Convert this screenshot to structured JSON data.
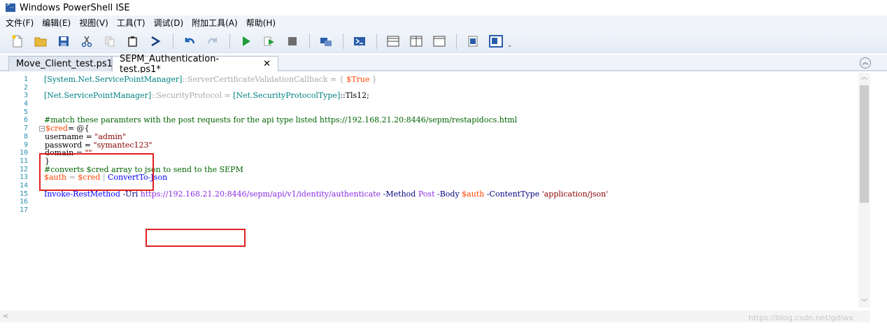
{
  "window": {
    "title": "Windows PowerShell ISE",
    "icon": "powershell-icon"
  },
  "menu": [
    "文件(F)",
    "编辑(E)",
    "视图(V)",
    "工具(T)",
    "调试(D)",
    "附加工具(A)",
    "帮助(H)"
  ],
  "toolbar": {
    "buttons": [
      "new-icon",
      "open-icon",
      "save-icon",
      "cut-icon",
      "copy-icon",
      "paste-icon",
      "console-icon",
      "undo-icon",
      "redo-icon",
      "run-icon",
      "run-selection-icon",
      "stop-icon",
      "remote-icon",
      "powershell-icon",
      "layout-top-icon",
      "layout-right-icon",
      "layout-max-icon",
      "addon-icon",
      "show-commands-icon"
    ],
    "overflow": "⌄"
  },
  "tabs": [
    {
      "label": "Move_Client_test.ps1",
      "active": false
    },
    {
      "label": "SEPM_Authentication-test.ps1*",
      "active": true,
      "close": "✕"
    }
  ],
  "editor": {
    "line_numbers": [
      "1",
      "2",
      "3",
      "4",
      "5",
      "6",
      "7",
      "8",
      "9",
      "10",
      "11",
      "12",
      "13",
      "14",
      "15",
      "16",
      "17"
    ],
    "code": {
      "l1_type": "[System.Net.ServicePointManager]",
      "l1_rest": "::ServerCertificateValidationCallback = { ",
      "l1_var": "$True",
      "l1_end": " }",
      "l3_type": "[Net.ServicePointManager]",
      "l3_mid": "::SecurityProtocol = ",
      "l3_type2": "[Net.SecurityProtocolType]",
      "l3_end": "::Tls12;",
      "l6_cmt": "#match these paramters with the post requests for the api type listed https://192.168.21.20:8446/sepm/restapidocs.html",
      "l7_fold": "−",
      "l7_var": "$cred",
      "l7_rest": "= @{",
      "l8_key": "username = ",
      "l8_val": "\"admin\"",
      "l9_key": "password = ",
      "l9_val": "\"symantec123\"",
      "l10_key": "domain = ",
      "l10_val": "\"\"",
      "l11": "}",
      "l12_cmt": "#converts $cred array to json to send to the SEPM",
      "l13_var1": "$auth",
      "l13_eq": " = ",
      "l13_var2": "$cred",
      "l13_pipe": " | ",
      "l13_cmd": "ConvertTo-Json",
      "l15_cmd": "Invoke-RestMethod",
      "l15_p1": " -Uri",
      "l15_url": " https://192.168.21.20:8446/sepm/api/v1/identity/authenticate",
      "l15_p2": " -Method",
      "l15_a2": " Post",
      "l15_p3": " -Body",
      "l15_var": " $auth",
      "l15_p4": " -ContentType",
      "l15_str": " 'application/json'"
    }
  },
  "scroll": {
    "up": "︿",
    "down": "﹀",
    "left": "<"
  },
  "watermark": "https://blog.csdn.net/gdlwx",
  "collapse": "︽"
}
